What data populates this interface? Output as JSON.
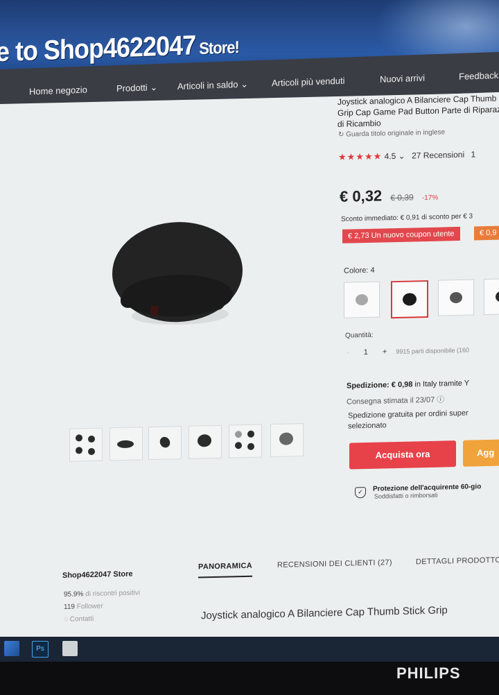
{
  "banner": {
    "title_main": "e to Shop4622047",
    "title_suffix": " Store!"
  },
  "nav": {
    "home": "Home negozio",
    "products": "Prodotti",
    "sale": "Articoli in saldo",
    "bestsellers": "Articoli più venduti",
    "new": "Nuovi arrivi",
    "feedback": "Feedback"
  },
  "product": {
    "title": "Joystick analogico A Bilanciere Cap Thumb Stick Grip Cap Game Pad Button Parte di Riparazione di Ricambio",
    "translate": "Guarda titolo originale in inglese",
    "stars": "★★★★★",
    "rating": "4.5",
    "reviews": "27 Recensioni",
    "reviews_extra": "1",
    "price": "€ 0,32",
    "price_old": "€ 0,39",
    "discount": "-17%",
    "instant": "Sconto immediato: € 0,91 di sconto per € 3",
    "coupon1": "€ 2,73 Un nuovo coupon utente",
    "coupon2": "€ 0,9",
    "color_label": "Colore: 4",
    "qty_label": "Quantità:",
    "qty_minus": "-",
    "qty_value": "1",
    "qty_plus": "+",
    "available": "9915 parti disponibile (160",
    "ship_label": "Spedizione: € 0,98",
    "ship_rest": " in Italy tramite Y",
    "delivery": "Consegna stimata il 23/07",
    "free_ship": "Spedizione gratuita per ordini super selezionato",
    "buy": "Acquista ora",
    "cart": "Agg",
    "protect": "Protezione dell'acquirente 60-gio",
    "protect_sub": "Soddisfatti o rimborsati"
  },
  "store": {
    "name": "Shop4622047 Store",
    "positive_value": "95.9%",
    "positive_label": " di riscontri positivi",
    "followers_value": "119",
    "followers_label": " Follower",
    "contact": "Contatti"
  },
  "tabs": {
    "overview": "PANORAMICA",
    "reviews": "RECENSIONI DEI CLIENTI (27)",
    "details": "DETTAGLI PRODOTTO"
  },
  "description_title": "Joystick analogico A Bilanciere Cap Thumb Stick Grip",
  "taskbar": {
    "ps": "Ps"
  },
  "monitor": {
    "brand": "PHILIPS"
  }
}
